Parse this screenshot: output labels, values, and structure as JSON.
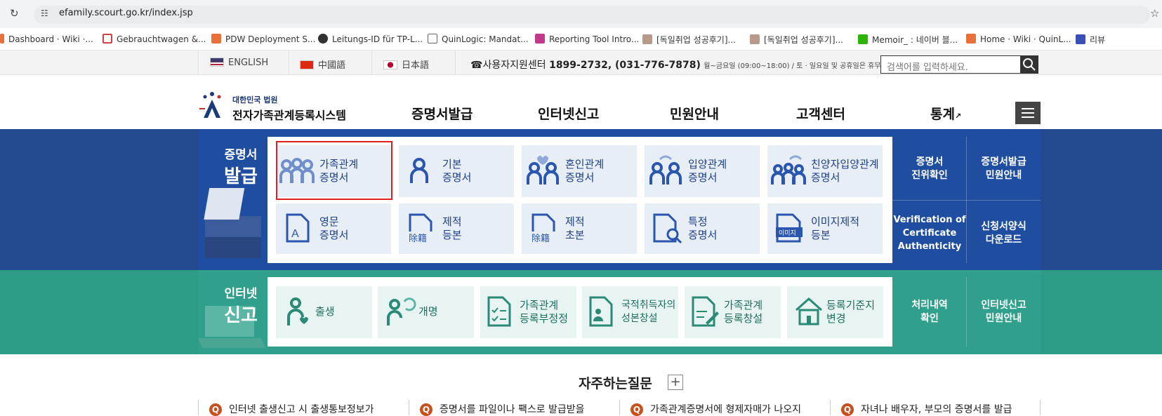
{
  "browser": {
    "url": "efamily.scourt.go.kr/index.jsp",
    "bookmarks": [
      "Dashboard · Wiki ·...",
      "Gebrauchtwagen &...",
      "PDW Deployment S...",
      "Leitungs-ID für TP-L...",
      "QuinLogic: Mandat...",
      "Reporting Tool Intro...",
      "[독일취업 성공후기]...",
      "[독일취업 성공후기]...",
      "Memoir_ : 네이버 블...",
      "Home · Wiki · QuinL...",
      "리뷰"
    ]
  },
  "util": {
    "english": "ENGLISH",
    "chinese": "中國語",
    "japanese": "日本語",
    "support_label": "사용자지원센터",
    "support_phone": "1899-2732, (031-776-7878)",
    "support_hours": "월~금요일 (09:00~18:00) / 토 · 일요일 및 공휴일은 휴무",
    "search_placeholder": "검색어를 입력하세요."
  },
  "header": {
    "court": "대한민국 법원",
    "system": "전자가족관계등록시스템",
    "nav": [
      "증명서발급",
      "인터넷신고",
      "민원안내",
      "고객센터",
      "통계"
    ]
  },
  "certificate": {
    "title_small": "증명서",
    "title_big": "발급",
    "cards": [
      {
        "line1": "가족관계",
        "line2": "증명서"
      },
      {
        "line1": "기본",
        "line2": "증명서"
      },
      {
        "line1": "혼인관계",
        "line2": "증명서"
      },
      {
        "line1": "입양관계",
        "line2": "증명서"
      },
      {
        "line1": "친양자입양관계",
        "line2": "증명서"
      },
      {
        "line1": "영문",
        "line2": "증명서"
      },
      {
        "line1": "제적",
        "line2": "등본"
      },
      {
        "line1": "제적",
        "line2": "초본"
      },
      {
        "line1": "특정",
        "line2": "증명서"
      },
      {
        "line1": "이미지제적",
        "line2": "등본"
      }
    ],
    "icon_texts": {
      "kanji": "除籍",
      "image_badge": "이미지",
      "alpha": "A"
    },
    "side": [
      {
        "line1": "증명서",
        "line2": "진위확인"
      },
      {
        "line1": "증명서발급",
        "line2": "민원안내"
      },
      {
        "line1": "Verification of",
        "line2": "Certificate",
        "line3": "Authenticity"
      },
      {
        "line1": "신청서양식",
        "line2": "다운로드"
      }
    ]
  },
  "report": {
    "title_small": "인터넷",
    "title_big": "신고",
    "cards": [
      {
        "line1": "출생",
        "line2": ""
      },
      {
        "line1": "개명",
        "line2": ""
      },
      {
        "line1": "가족관계",
        "line2": "등록부정정"
      },
      {
        "line1": "국적취득자의",
        "line2": "성본창설"
      },
      {
        "line1": "가족관계",
        "line2": "등록창설"
      },
      {
        "line1": "등록기준지",
        "line2": "변경"
      }
    ],
    "side": [
      {
        "line1": "처리내역",
        "line2": "확인"
      },
      {
        "line1": "인터넷신고",
        "line2": "민원안내"
      }
    ]
  },
  "faq": {
    "title": "자주하는질문",
    "plus": "+",
    "q": "Q",
    "items": [
      "인터넷 출생신고 시 출생통보정보가",
      "증명서를 파일이나 팩스로 발급받을",
      "가족관계증명서에 형제자매가 나오지",
      "자녀나 배우자, 부모의 증명서를 발급"
    ]
  },
  "colors": {
    "blue_band": "#23498f",
    "green_band": "#2e9b87",
    "highlight": "#e02020"
  }
}
